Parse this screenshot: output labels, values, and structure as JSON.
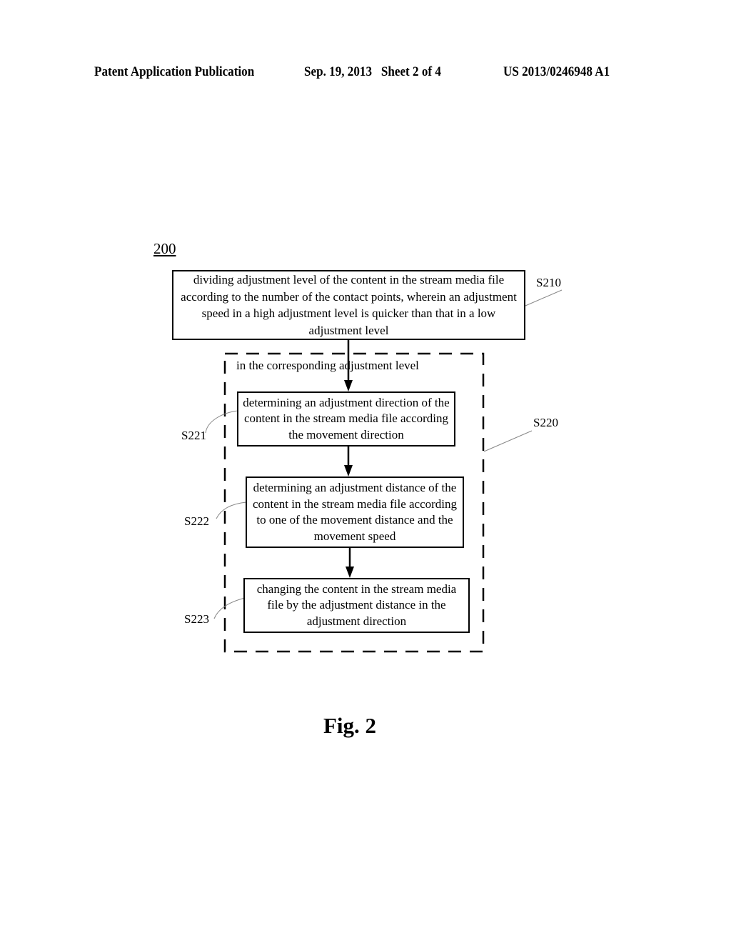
{
  "header": {
    "publication": "Patent Application Publication",
    "date_sheet": "Sep. 19, 2013   Sheet 2 of 4",
    "number": "US 2013/0246948 A1"
  },
  "diagram": {
    "ref_number": "200",
    "steps": [
      {
        "id": "S210",
        "text": "dividing adjustment level of the content in the stream media file according to the number of the contact points, wherein an adjustment speed in a high adjustment level is quicker than that in a low adjustment level"
      },
      {
        "id": "S221",
        "text": "determining an adjustment direction of the content in the stream media file according the movement direction"
      },
      {
        "id": "S222",
        "text": "determining an adjustment distance of the content in the stream media file according to one of the movement distance and the movement speed"
      },
      {
        "id": "S223",
        "text": "changing the content in the stream media file by the adjustment distance in the adjustment direction"
      }
    ],
    "group": {
      "id": "S220",
      "caption": "in the corresponding adjustment level"
    },
    "figure_label": "Fig. 2"
  }
}
